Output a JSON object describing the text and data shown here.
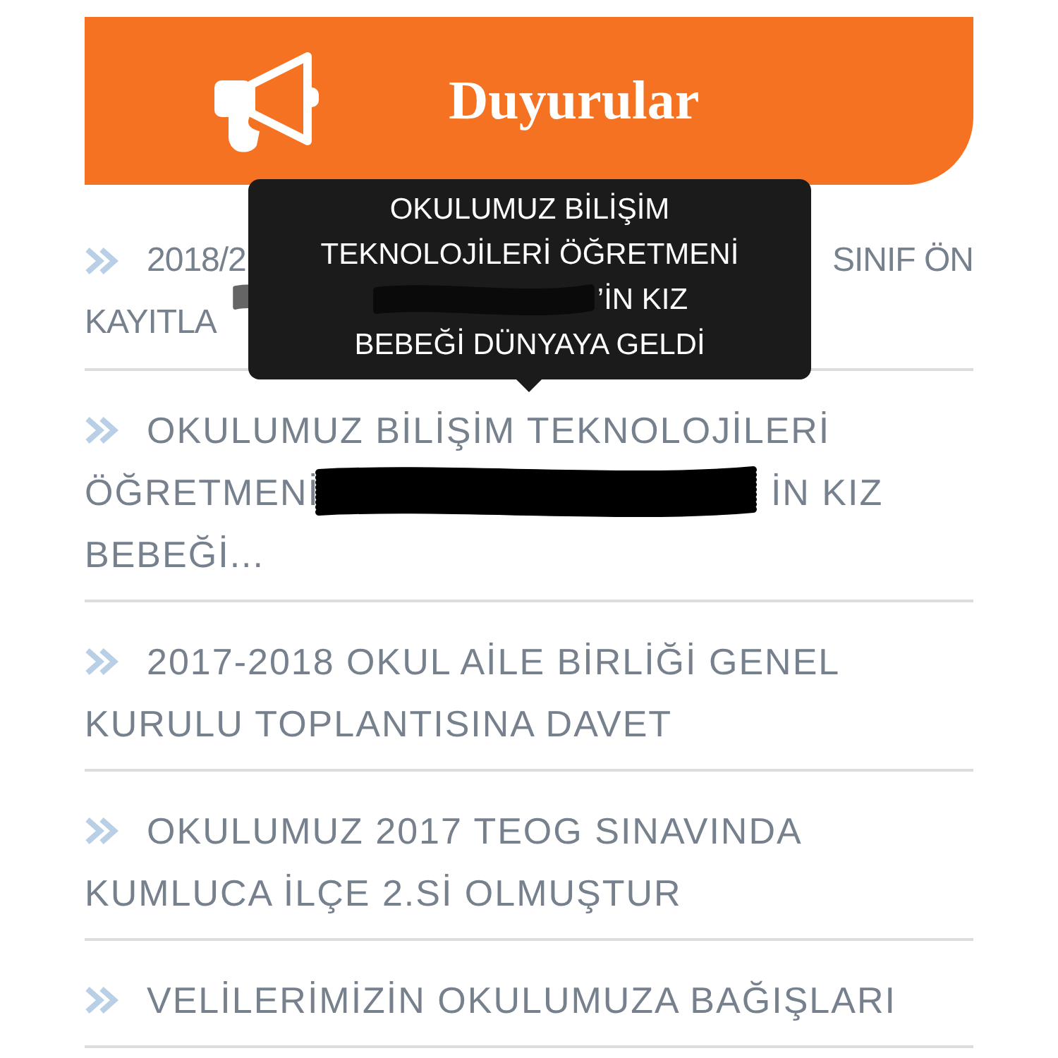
{
  "header": {
    "title": "Duyurular"
  },
  "announcements": [
    {
      "kind": "covered",
      "lines": [
        [
          "2018/2",
          "SINIF ÖN"
        ],
        [
          "KAYITLA"
        ]
      ]
    },
    {
      "kind": "redacted",
      "lines": [
        [
          "OKULUMUZ BİLİŞİM TEKNOLOJİLERİ"
        ],
        [
          "ÖĞRETMENİ",
          "İN KIZ"
        ],
        [
          "BEBEĞİ..."
        ]
      ]
    },
    {
      "kind": "plain",
      "text": "2017-2018 OKUL AİLE BİRLİĞİ GENEL KURULU TOPLANTISINA DAVET"
    },
    {
      "kind": "plain",
      "text": "OKULUMUZ 2017 TEOG SINAVINDA KUMLUCA İLÇE 2.Sİ OLMUŞTUR"
    },
    {
      "kind": "plain",
      "text": "VELİLERİMİZİN OKULUMUZA BAĞIŞLARI"
    }
  ],
  "tooltip": {
    "lines": [
      {
        "kind": "plain",
        "text": "OKULUMUZ BİLİŞİM"
      },
      {
        "kind": "plain",
        "text": "TEKNOLOJİLERİ ÖĞRETMENİ"
      },
      {
        "kind": "redacted",
        "text": "’İN KIZ"
      },
      {
        "kind": "plain",
        "text": "BEBEĞİ DÜNYAYA GELDİ"
      }
    ]
  }
}
